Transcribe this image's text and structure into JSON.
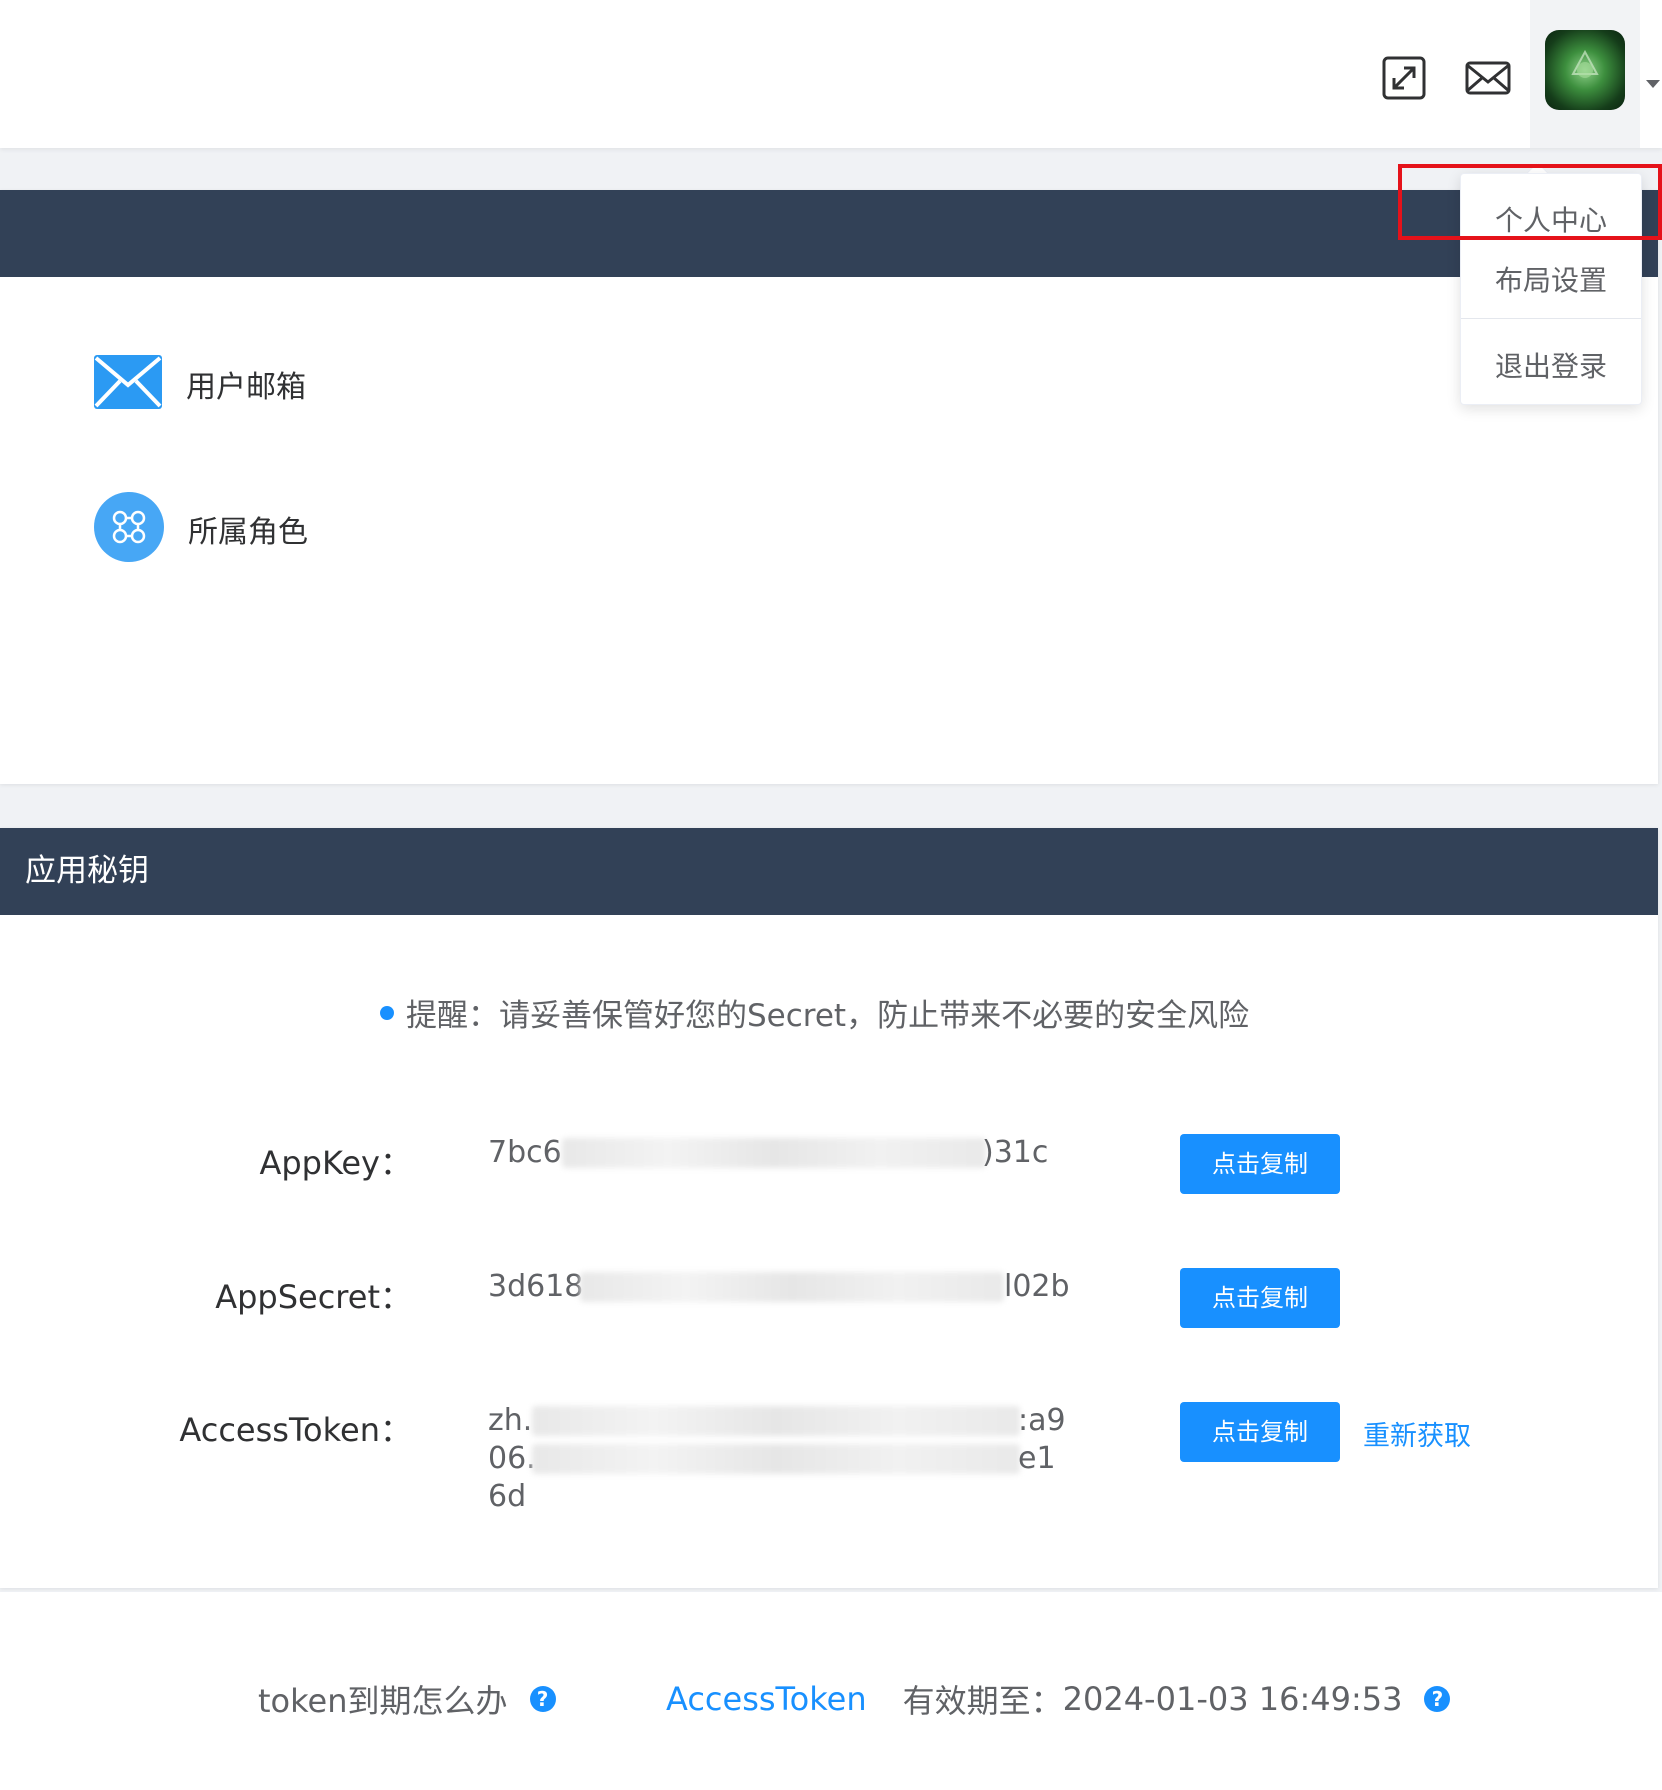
{
  "header": {
    "fullscreen_icon": "fullscreen-icon",
    "mail_icon": "mail-icon",
    "avatar_icon": "avatar-image"
  },
  "user_dropdown": {
    "items": [
      "个人中心",
      "布局设置",
      "退出登录"
    ]
  },
  "profile_card": {
    "rows": [
      {
        "icon": "envelope-icon",
        "label": "用户邮箱"
      },
      {
        "icon": "role-icon",
        "label": "所属角色"
      }
    ]
  },
  "secret_card": {
    "title": "应用秘钥",
    "reminder": "提醒：请妥善保管好您的Secret，防止带来不必要的安全风险",
    "fields": [
      {
        "label": "AppKey：",
        "value_start": "7bc6",
        "value_end": ")31c",
        "button": "点击复制"
      },
      {
        "label": "AppSecret：",
        "value_start": "3d618",
        "value_end": "l02b",
        "button": "点击复制"
      },
      {
        "label": "AccessToken：",
        "value_lines": [
          [
            "zh.",
            ":a9"
          ],
          [
            "06.",
            "e1"
          ],
          [
            "6d",
            ""
          ]
        ],
        "button": "点击复制",
        "refresh": "重新获取"
      }
    ]
  },
  "footer": {
    "token_expire_question": "token到期怎么办",
    "access_token_link": "AccessToken",
    "valid_until_label": "有效期至：",
    "valid_until_value": "2024-01-03 16:49:53"
  },
  "colors": {
    "primary": "#1890ff",
    "header_dark": "#324157",
    "highlight": "#e5121a"
  }
}
